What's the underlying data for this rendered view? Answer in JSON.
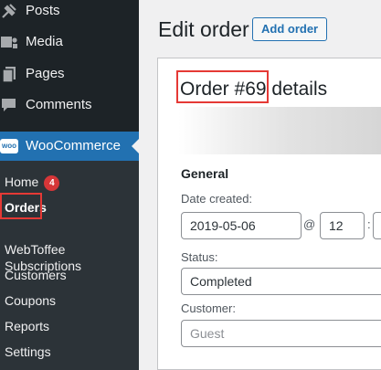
{
  "sidebar": {
    "items": [
      {
        "label": "Posts",
        "icon": "pin-icon"
      },
      {
        "label": "Media",
        "icon": "media-icon"
      },
      {
        "label": "Pages",
        "icon": "pages-icon"
      },
      {
        "label": "Comments",
        "icon": "comment-icon"
      }
    ],
    "woocommerce": {
      "label": "WooCommerce",
      "icon": "woocommerce-logo-icon",
      "logo_text": "woo"
    },
    "submenu": [
      {
        "label": "Home",
        "badge": "4"
      },
      {
        "label": "Orders",
        "active": true
      },
      {
        "label": "WebToffee\nSubscriptions"
      },
      {
        "label": "Customers"
      },
      {
        "label": "Coupons"
      },
      {
        "label": "Reports"
      },
      {
        "label": "Settings"
      }
    ]
  },
  "header": {
    "title": "Edit order",
    "add_button": "Add order"
  },
  "order": {
    "number_text": "Order #69",
    "details_text": "details",
    "general_heading": "General",
    "date_label": "Date created:",
    "date_value": "2019-05-06",
    "at_symbol": "@",
    "hour_value": "12",
    "time_separator": ":",
    "status_label": "Status:",
    "status_value": "Completed",
    "customer_label": "Customer:",
    "customer_placeholder": "Guest"
  },
  "colors": {
    "sidebar_bg": "#1d2327",
    "submenu_bg": "#2c3338",
    "accent": "#2271b1",
    "badge": "#d63638",
    "highlight_box": "#e53935"
  }
}
